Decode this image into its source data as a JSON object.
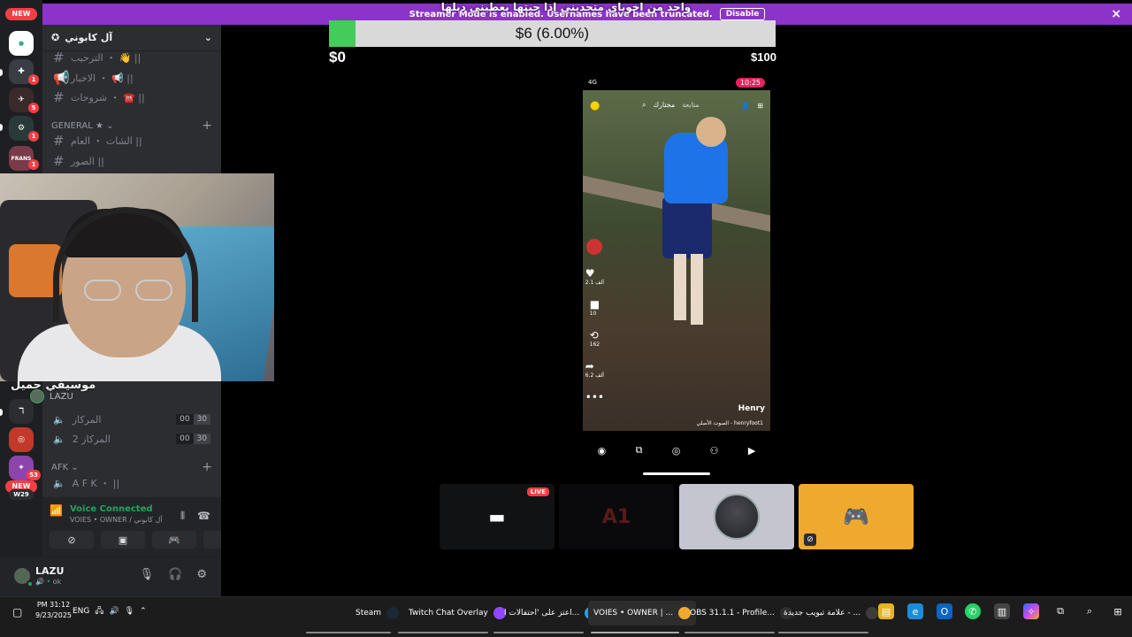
{
  "overlay": {
    "title": "واحد من اخوياي متحديني إذا جبتها يعطيني دبلها"
  },
  "banner": {
    "text": "Streamer Mode is enabled. Usernames have been truncated.",
    "disable_label": "Disable",
    "close_icon": "×",
    "color": "#8c33c9"
  },
  "goal": {
    "label": "$6 (6.00%)",
    "min": "$0",
    "max": "$100",
    "progress_fraction": 0.06,
    "fill_color": "#44cc5a"
  },
  "rail": {
    "new_top": "NEW",
    "new_bottom": "NEW",
    "badges": [
      "1",
      "5",
      "1",
      "1",
      "1",
      "53"
    ],
    "server_labels": [
      "FRANS",
      "W29"
    ]
  },
  "server": {
    "name": "آل كابوني",
    "channels_top": [
      {
        "name": "الترحيب ・ 👋 ||"
      },
      {
        "name": "الاخبار ・ 📢 ||"
      },
      {
        "name": "شروحات ・ ☎️ ||"
      }
    ],
    "general_category": "GENERAL ★",
    "channels_general": [
      {
        "name": "الشات ・ العام ||"
      },
      {
        "name": "الصور ||"
      }
    ]
  },
  "voice": {
    "category_title": "موسيقي جميل",
    "user": "LAZU",
    "channels": [
      {
        "name": "المركاز",
        "count_a": "00",
        "count_b": "30"
      },
      {
        "name": "2 المركاز",
        "count_a": "00",
        "count_b": "30"
      }
    ],
    "afk_category": "AFK",
    "afk_channel": "A F K ・ ||"
  },
  "voice_panel": {
    "status": "Voice Connected",
    "location": "VOIES • OWNER / آل كابوني",
    "status_color": "#23a55a"
  },
  "user_panel": {
    "name": "LAZU",
    "status": "ok"
  },
  "phone": {
    "network": "4G",
    "time": "10:25",
    "tab_following": "متابعة",
    "tab_foryou": "مختارك",
    "likes": "2.1 ألف",
    "comments": "10",
    "reposts": "162",
    "shares": "6.2 ألف",
    "creator": "Henry",
    "sound": "الصوت الأصلي - henryfoot1"
  },
  "tiles": {
    "live_label": "LIVE",
    "ghost_text": "A1"
  },
  "taskbar": {
    "time": "PM 31:12",
    "date": "9/23/2025",
    "lang": "ENG",
    "apps": [
      {
        "label": "Steam",
        "icon_color": "#1b2838"
      },
      {
        "label": "Twitch Chat Overlay",
        "icon_color": "#9146ff"
      },
      {
        "label": "اعتز على 'احتفالات ا...",
        "icon_color": "#1da1f2"
      },
      {
        "label": "VOIES • OWNER | ...",
        "icon_color": "#f0a92f"
      },
      {
        "label": "OBS 31.1.1 - Profile...",
        "icon_color": "#302e31"
      },
      {
        "label": "علامة تبويب جديدة - ...",
        "icon_color": "#3c3c3c"
      }
    ]
  }
}
